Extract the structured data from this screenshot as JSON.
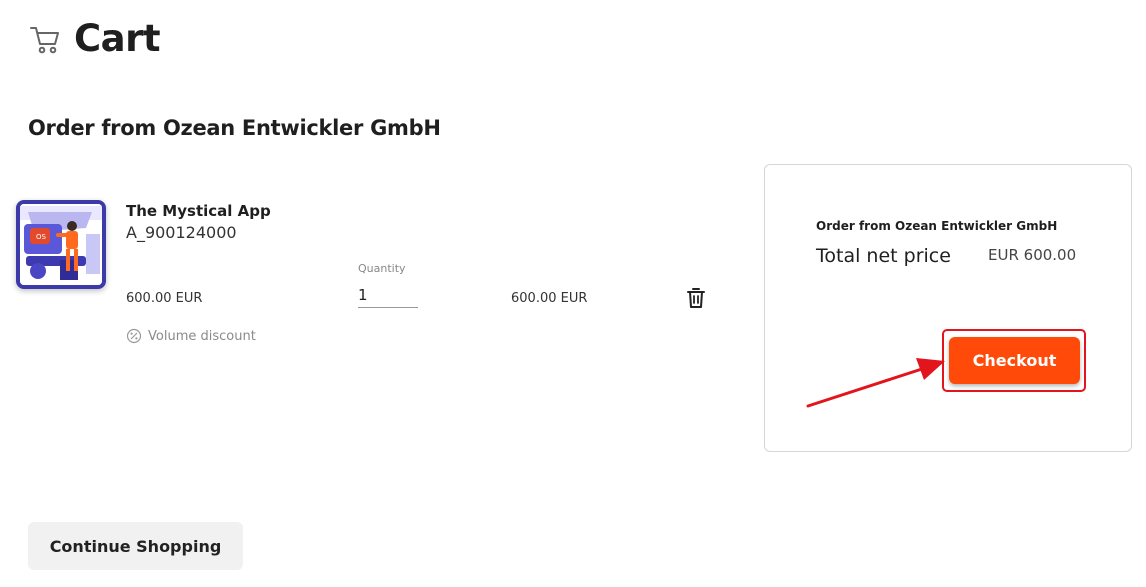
{
  "header": {
    "title": "Cart",
    "icon": "cart-icon"
  },
  "order": {
    "heading": "Order from Ozean Entwickler GmbH"
  },
  "item": {
    "name": "The Mystical App",
    "sku": "A_900124000",
    "unit_price": "600.00 EUR",
    "quantity_label": "Quantity",
    "quantity_value": "1",
    "line_total": "600.00 EUR",
    "discount_label": "Volume discount",
    "delete_icon": "trash-icon",
    "discount_icon": "percent-icon"
  },
  "summary": {
    "vendor": "Order from Ozean Entwickler GmbH",
    "total_label": "Total net price",
    "total_value": "EUR 600.00",
    "checkout_label": "Checkout"
  },
  "actions": {
    "continue_label": "Continue Shopping"
  },
  "colors": {
    "accent": "#ff4a0a",
    "highlight": "#e3151c",
    "thumb_border": "#3b3aa8"
  }
}
